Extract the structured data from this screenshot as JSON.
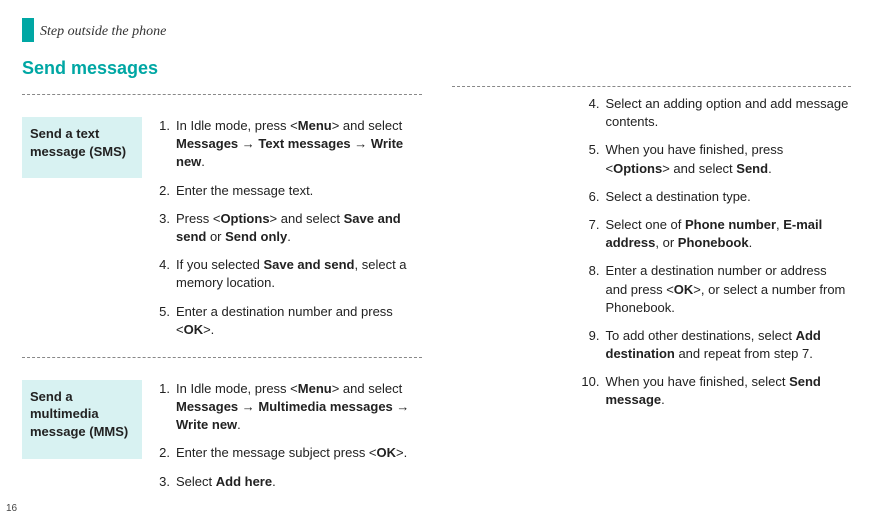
{
  "header": {
    "chapter": "Step outside the phone",
    "section": "Send messages",
    "page_number": "16"
  },
  "left": {
    "block1": {
      "label": "Send a text message (SMS)",
      "steps": [
        {
          "n": "1.",
          "html": "In Idle mode, press <<b>Menu</b>> and select <b>Messages</b> → <b>Text messages</b> → <b>Write new</b>."
        },
        {
          "n": "2.",
          "html": "Enter the message text."
        },
        {
          "n": "3.",
          "html": "Press <<b>Options</b>> and select <b>Save and send</b> or <b>Send only</b>."
        },
        {
          "n": "4.",
          "html": "If you selected <b>Save and send</b>, select a memory location."
        },
        {
          "n": "5.",
          "html": "Enter a destination number and press <<b>OK</b>>."
        }
      ]
    },
    "block2": {
      "label": "Send a multimedia message (MMS)",
      "steps": [
        {
          "n": "1.",
          "html": "In Idle mode, press <<b>Menu</b>> and select <b>Messages</b> → <b>Multimedia messages</b> → <b>Write new</b>."
        },
        {
          "n": "2.",
          "html": "Enter the message subject press <<b>OK</b>>."
        },
        {
          "n": "3.",
          "html": "Select <b>Add here</b>."
        }
      ]
    }
  },
  "right": {
    "steps": [
      {
        "n": "4.",
        "html": "Select an adding option and add message contents."
      },
      {
        "n": "5.",
        "html": "When you have finished, press <<b>Options</b>> and select <b>Send</b>."
      },
      {
        "n": "6.",
        "html": "Select a destination type."
      },
      {
        "n": "7.",
        "html": "Select one of <b>Phone number</b>, <b>E-mail address</b>, or <b>Phonebook</b>."
      },
      {
        "n": "8.",
        "html": "Enter a destination number or address and press <<b>OK</b>>, or select a number from Phonebook."
      },
      {
        "n": "9.",
        "html": "To add other destinations, select <b>Add destination</b> and repeat from step 7."
      },
      {
        "n": "10.",
        "html": "When you have finished, select <b>Send message</b>."
      }
    ]
  }
}
